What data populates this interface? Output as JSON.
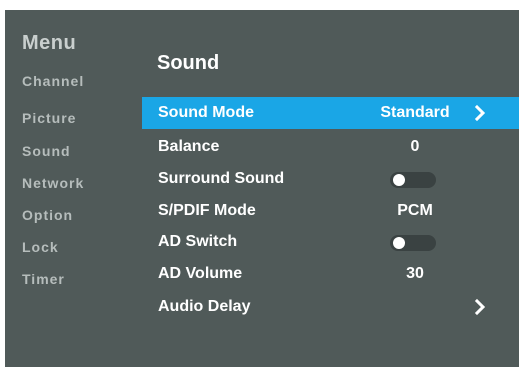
{
  "sidebar": {
    "title": "Menu",
    "items": [
      {
        "label": "Channel"
      },
      {
        "label": "Picture"
      },
      {
        "label": "Sound"
      },
      {
        "label": "Network"
      },
      {
        "label": "Option"
      },
      {
        "label": "Lock"
      },
      {
        "label": "Timer"
      }
    ]
  },
  "main": {
    "title": "Sound",
    "rows": [
      {
        "label": "Sound  Mode",
        "value": "Standard",
        "icon": "chevron-right-icon",
        "selected": true
      },
      {
        "label": "Balance",
        "value": "0"
      },
      {
        "label": "Surround  Sound",
        "toggle": "off"
      },
      {
        "label": "S/PDIF  Mode",
        "value": "PCM"
      },
      {
        "label": "AD Switch",
        "toggle": "off"
      },
      {
        "label": "AD Volume",
        "value": "30"
      },
      {
        "label": "Audio Delay",
        "icon": "chevron-right-icon"
      }
    ]
  },
  "colors": {
    "background": "#505a59",
    "highlight": "#1aa6e6",
    "sidebar_text": "#b6bdbc",
    "toggle_track": "#3a4242"
  }
}
